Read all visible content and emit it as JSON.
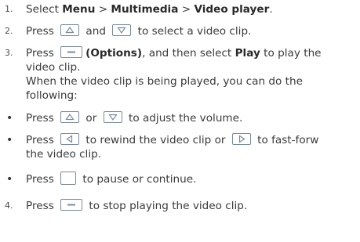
{
  "steps": [
    {
      "num": "1.",
      "pre": "Select ",
      "menu": "Menu",
      "sep1": " > ",
      "multimedia": "Multimedia",
      "sep2": " > ",
      "videoplayer": "Video player",
      "post": "."
    },
    {
      "num": "2.",
      "pre": "Press ",
      "mid": " and ",
      "post": " to select a video clip."
    },
    {
      "num": "3.",
      "pre": "Press ",
      "options": "(Options)",
      "mid": ", and then select ",
      "play": "Play",
      "post": " to play the",
      "cont": "video clip.",
      "note1": "When the video clip is being played, you can do the",
      "note2": "following:"
    },
    {
      "num": "4.",
      "pre": "Press ",
      "post": " to stop playing the video clip."
    }
  ],
  "bullets": [
    {
      "symbol": "•",
      "pre": "Press ",
      "mid": " or ",
      "post": " to adjust the volume."
    },
    {
      "symbol": "•",
      "pre": "Press ",
      "mid": " to rewind the video clip or ",
      "post": " to fast-forw",
      "cont": "the video clip."
    },
    {
      "symbol": "•",
      "pre": "Press ",
      "post": " to pause or continue."
    }
  ],
  "icons": {
    "up": "up-arrow-key-icon",
    "down": "down-arrow-key-icon",
    "left": "left-arrow-key-icon",
    "right": "right-arrow-key-icon",
    "softkey": "left-soft-key-icon",
    "center": "center-key-icon"
  },
  "colors": {
    "key_border": "#7a8b9b",
    "text": "#3a3a3a"
  }
}
